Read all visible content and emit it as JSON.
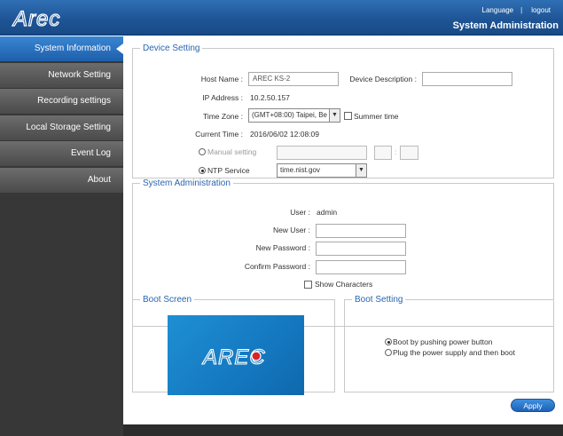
{
  "header": {
    "brand": "AREC",
    "language_link": "Language",
    "separator": "|",
    "logout_link": "logout",
    "title": "System Administration",
    "colors": {
      "header_blue": "#1f5596",
      "active_blue": "#2a72c2",
      "sidebar_dark": "#373737",
      "legend_blue": "#2a65b0"
    }
  },
  "sidebar": {
    "items": [
      {
        "label": "System Information",
        "active": true
      },
      {
        "label": "Network Setting",
        "active": false
      },
      {
        "label": "Recording settings",
        "active": false
      },
      {
        "label": "Local Storage Setting",
        "active": false
      },
      {
        "label": "Event Log",
        "active": false
      },
      {
        "label": "About",
        "active": false
      }
    ]
  },
  "device_setting": {
    "legend": "Device Setting",
    "host_name_label": "Host Name",
    "host_name_value": "AREC KS-2",
    "device_description_label": "Device Description",
    "device_description_value": "",
    "ip_address_label": "IP Address",
    "ip_address_value": "10.2.50.157",
    "time_zone_label": "Time Zone",
    "time_zone_value": "(GMT+08:00) Taipei, Be",
    "summer_time_label": "Summer time",
    "summer_time_checked": false,
    "current_time_label": "Current Time",
    "current_time_value": "2016/06/02 12:08:09",
    "manual_setting_label": "Manual setting",
    "manual_date_value": "",
    "manual_hour_value": "",
    "manual_minute_value": "",
    "time_separator": ":",
    "ntp_label": "NTP Service",
    "ntp_server_value": "time.nist.gov",
    "colon": ":"
  },
  "system_admin": {
    "legend": "System Administration",
    "user_label": "User",
    "user_value": "admin",
    "new_user_label": "New User",
    "new_password_label": "New Password",
    "confirm_password_label": "Confirm Password",
    "show_characters_label": "Show Characters",
    "show_characters_checked": false,
    "colon": ":"
  },
  "boot_screen": {
    "legend": "Boot Screen",
    "logo_text": "AREC"
  },
  "boot_setting": {
    "legend": "Boot Setting",
    "options": [
      {
        "label": "Boot by pushing power button",
        "selected": true
      },
      {
        "label": "Plug the power supply and then boot",
        "selected": false
      }
    ]
  },
  "actions": {
    "apply_label": "Apply"
  }
}
